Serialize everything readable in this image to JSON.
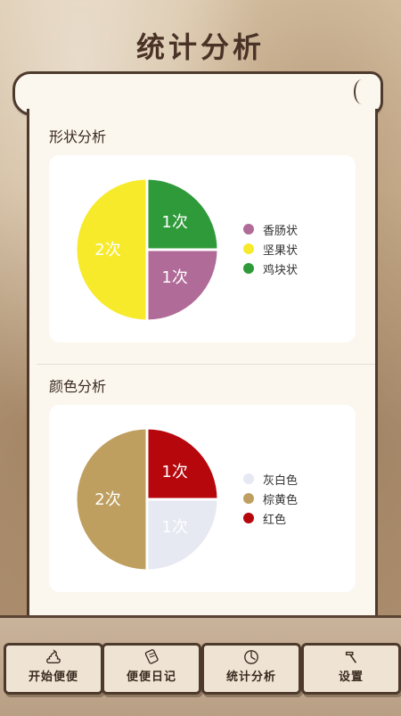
{
  "header": {
    "title": "统计分析"
  },
  "sections": [
    {
      "title": "形状分析",
      "chart_data": {
        "type": "pie",
        "categories": [
          "香肠状",
          "坚果状",
          "鸡块状"
        ],
        "values": [
          1,
          2,
          1
        ],
        "labels": [
          "1次",
          "2次",
          "1次"
        ],
        "colors": [
          "#b06b98",
          "#f7ea2b",
          "#2f9a3a"
        ]
      }
    },
    {
      "title": "颜色分析",
      "chart_data": {
        "type": "pie",
        "categories": [
          "灰白色",
          "棕黄色",
          "红色"
        ],
        "values": [
          1,
          2,
          1
        ],
        "labels": [
          "1次",
          "2次",
          "1次"
        ],
        "colors": [
          "#e6e8f2",
          "#bf9f5f",
          "#b5070c"
        ]
      }
    }
  ],
  "nav": {
    "items": [
      {
        "label": "开始便便",
        "icon": "poop-icon"
      },
      {
        "label": "便便日记",
        "icon": "diary-icon"
      },
      {
        "label": "统计分析",
        "icon": "clock-chart-icon"
      },
      {
        "label": "设置",
        "icon": "hammer-icon"
      }
    ]
  }
}
